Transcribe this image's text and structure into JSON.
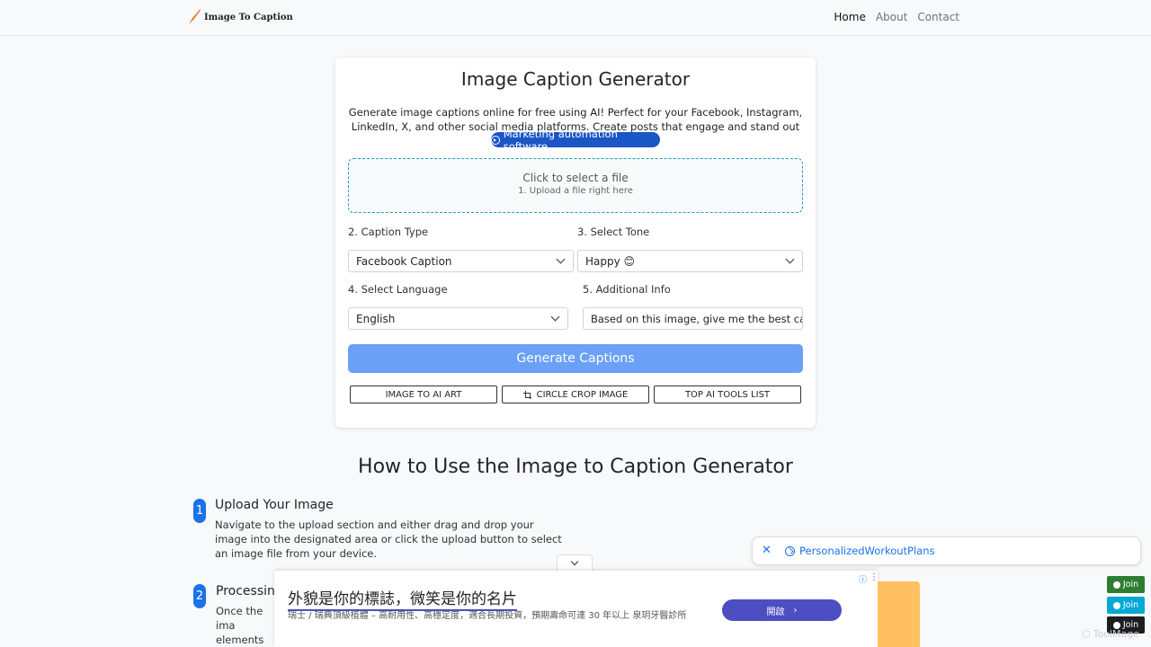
{
  "nav": {
    "brand": "Image To Caption",
    "links": [
      "Home",
      "About",
      "Contact"
    ]
  },
  "card": {
    "title": "Image Caption Generator",
    "description": "Generate image captions online for free using AI! Perfect for your Facebook, Instagram, LinkedIn, X, and other social media platforms. Create posts that engage and stand out in just seconds!",
    "pill_label": "Marketing automation software",
    "upload": {
      "primary": "Click to select a file",
      "secondary": "1. Upload a file right here"
    },
    "caption_type": {
      "label": "2. Caption Type",
      "value": "Facebook Caption"
    },
    "tone": {
      "label": "3. Select Tone",
      "value": "Happy 😊"
    },
    "language": {
      "label": "4. Select Language",
      "value": "English"
    },
    "additional": {
      "label": "5. Additional Info",
      "value": "Based on this image, give me the best caption"
    },
    "generate_label": "Generate Captions",
    "tool_buttons": [
      "IMAGE TO AI ART",
      "CIRCLE CROP IMAGE",
      "TOP AI TOOLS LIST"
    ]
  },
  "howto": {
    "title": "How to Use the Image to Caption Generator",
    "steps": [
      {
        "num": "1",
        "heading": "Upload Your Image",
        "text": "Navigate to the upload section and either drag and drop your image into the designated area or click the upload button to select an image file from your device."
      },
      {
        "num": "2",
        "heading": "Processing",
        "text": "Once the ima elements and"
      }
    ]
  },
  "ad": {
    "headline": "外貌是你的標誌，微笑是你的名片",
    "subtext": "瑞士 / 瑞典頂級植體 – 高耐用性、高穩定度，適合長期投資，預期壽命可達 30 年以上 泉玥牙醫診所",
    "button": "開啟"
  },
  "toast": {
    "text": "PersonalizedWorkoutPlans"
  },
  "join": {
    "labels": [
      "Join",
      "Join",
      "Join"
    ],
    "colors": [
      "#2e7d32",
      "#03a9d4",
      "#1e1e1e"
    ]
  },
  "watermark": "ToolMage",
  "colors": {
    "primary": "#1a56c6",
    "generate": "#6aa1f6",
    "upload_border": "#17a2b8",
    "ad_accent": "#4b4fc2"
  }
}
